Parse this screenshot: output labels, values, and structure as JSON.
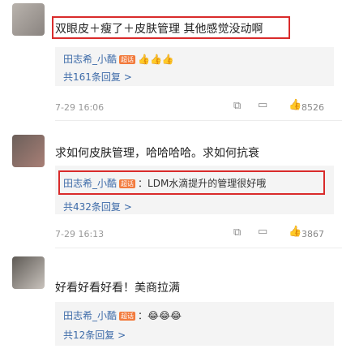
{
  "comments": [
    {
      "text": "双眼皮＋瘦了＋皮肤管理 其他感觉没动啊",
      "reply_user": "田志希_小酷",
      "reply_badge": "超话",
      "reply_text": "👍👍👍",
      "more": "共161条回复 >",
      "time": "7-29 16:06",
      "likes": "8526"
    },
    {
      "text": "求如何皮肤管理，哈哈哈哈。求如何抗衰",
      "reply_user": "田志希_小酷",
      "reply_badge": "超话",
      "reply_text": "：LDM水滴提升的管理很好哦",
      "more": "共432条回复 >",
      "time": "7-29 16:13",
      "likes": "3867"
    },
    {
      "text": "好看好看好看！美商拉满",
      "reply_user": "田志希_小酷",
      "reply_badge": "超话",
      "reply_text": "：😂😂😂",
      "more": "共12条回复 >"
    }
  ],
  "icons": {
    "edit": "edit-icon",
    "comment": "comment-icon",
    "like": "thumb-up-icon"
  },
  "colors": {
    "highlight": "#d92b2b",
    "username": "#3c6aa8",
    "badge": "#f27a3c"
  }
}
